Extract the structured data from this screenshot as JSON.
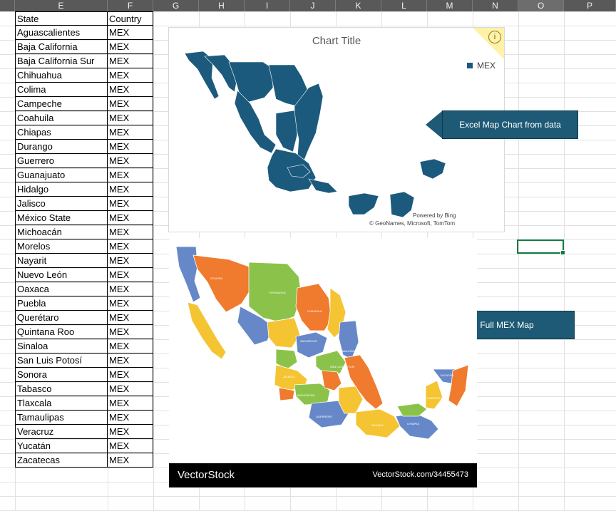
{
  "columns": [
    "E",
    "F",
    "G",
    "H",
    "I",
    "J",
    "K",
    "L",
    "M",
    "N",
    "O",
    "P"
  ],
  "table": {
    "headers": [
      "State",
      "Country"
    ],
    "rows": [
      [
        "Aguascalientes",
        "MEX"
      ],
      [
        "Baja California",
        "MEX"
      ],
      [
        "Baja California Sur",
        "MEX"
      ],
      [
        "Chihuahua",
        "MEX"
      ],
      [
        "Colima",
        "MEX"
      ],
      [
        "Campeche",
        "MEX"
      ],
      [
        "Coahuila",
        "MEX"
      ],
      [
        "Chiapas",
        "MEX"
      ],
      [
        "Durango",
        "MEX"
      ],
      [
        "Guerrero",
        "MEX"
      ],
      [
        "Guanajuato",
        "MEX"
      ],
      [
        "Hidalgo",
        "MEX"
      ],
      [
        "Jalisco",
        "MEX"
      ],
      [
        "México State",
        "MEX"
      ],
      [
        "Michoacán",
        "MEX"
      ],
      [
        "Morelos",
        "MEX"
      ],
      [
        "Nayarit",
        "MEX"
      ],
      [
        "Nuevo León",
        "MEX"
      ],
      [
        "Oaxaca",
        "MEX"
      ],
      [
        "Puebla",
        "MEX"
      ],
      [
        "Querétaro",
        "MEX"
      ],
      [
        "Quintana Roo",
        "MEX"
      ],
      [
        "Sinaloa",
        "MEX"
      ],
      [
        "San Luis Potosí",
        "MEX"
      ],
      [
        "Sonora",
        "MEX"
      ],
      [
        "Tabasco",
        "MEX"
      ],
      [
        "Tlaxcala",
        "MEX"
      ],
      [
        "Tamaulipas",
        "MEX"
      ],
      [
        "Veracruz",
        "MEX"
      ],
      [
        "Yucatán",
        "MEX"
      ],
      [
        "Zacatecas",
        "MEX"
      ]
    ]
  },
  "map_chart": {
    "title": "Chart Title",
    "legend": "MEX",
    "info_icon": "info-icon",
    "powered_by": "Powered by Bing",
    "attribution": "© GeoNames, Microsoft, TomTom",
    "fill_color": "#1c5a7d"
  },
  "callouts": {
    "excel_map": "Excel Map Chart from data",
    "full_map": "Full MEX Map"
  },
  "vectorstock": {
    "logo": "VectorStock",
    "id": "VectorStock.com/34455473"
  },
  "colors": {
    "header_bg": "#595959",
    "callout_bg": "#1e5a76",
    "selection": "#107c41"
  }
}
